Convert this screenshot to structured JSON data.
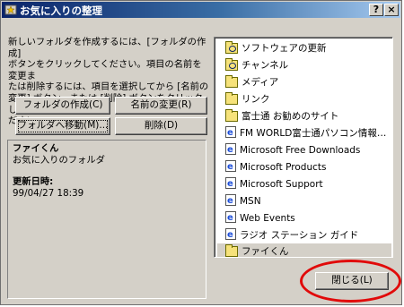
{
  "window": {
    "title": "お気に入りの整理",
    "help_label": "?",
    "close_label": "×"
  },
  "description": "新しいフォルダを作成するには、[フォルダの作成]\nボタンをクリックしてください。項目の名前を変更ま\nたは削除するには、項目を選択してから [名前の\n変更] ボタン、または [削除] ボタンをクリックしてく\nださい。",
  "buttons": {
    "create_folder": "フォルダの作成(C)",
    "rename": "名前の変更(R)",
    "move_to_folder": "フォルダへ移動(M)...",
    "delete": "削除(D)",
    "close": "閉じる(L)"
  },
  "info": {
    "name": "ファイくん",
    "type": "お気に入りのフォルダ",
    "modified_label": "更新日時:",
    "modified_value": "99/04/27 18:39"
  },
  "favorites": [
    {
      "label": "ソフトウェアの更新",
      "icon": "channel-folder-icon"
    },
    {
      "label": "チャンネル",
      "icon": "channel-folder-icon"
    },
    {
      "label": "メディア",
      "icon": "folder-icon"
    },
    {
      "label": "リンク",
      "icon": "folder-icon"
    },
    {
      "label": "富士通 お勧めのサイト",
      "icon": "folder-icon"
    },
    {
      "label": "FM WORLD富士通パソコン情報ペー...",
      "icon": "ie-page-icon"
    },
    {
      "label": "Microsoft Free Downloads",
      "icon": "ie-page-icon"
    },
    {
      "label": "Microsoft Products",
      "icon": "ie-page-icon"
    },
    {
      "label": "Microsoft Support",
      "icon": "ie-page-icon"
    },
    {
      "label": "MSN",
      "icon": "ie-page-icon"
    },
    {
      "label": "Web Events",
      "icon": "ie-page-icon"
    },
    {
      "label": "ラジオ ステーション ガイド",
      "icon": "ie-page-icon"
    },
    {
      "label": "ファイくん",
      "icon": "folder-icon",
      "selected": true
    }
  ],
  "colors": {
    "title_bar_start": "#0a246a",
    "highlight_ellipse": "#e10a0a"
  }
}
